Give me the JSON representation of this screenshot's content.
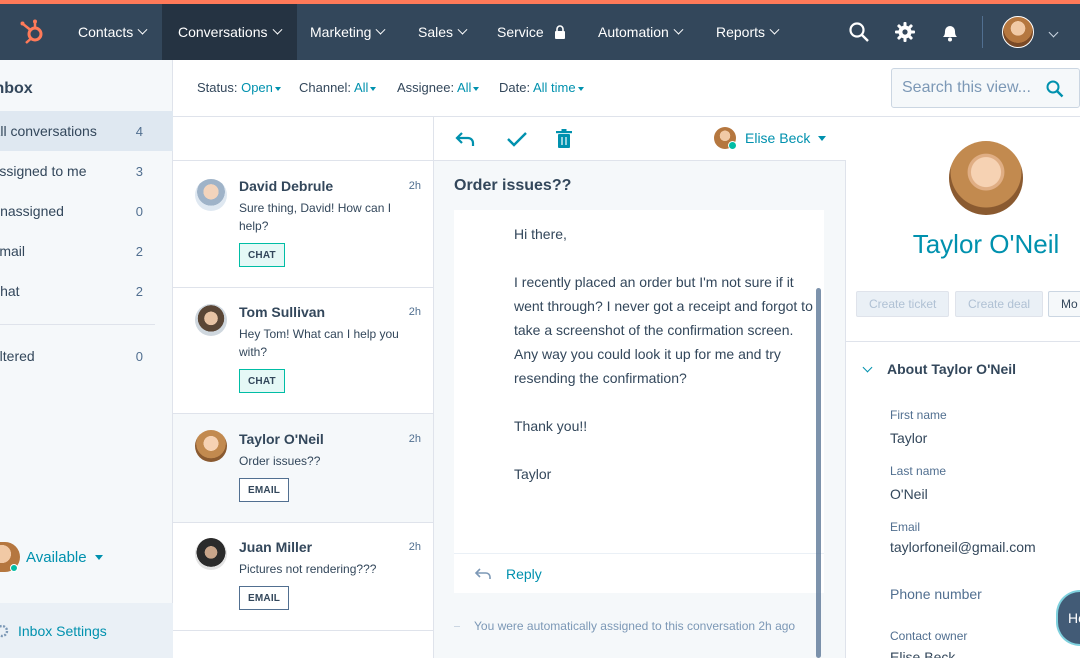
{
  "nav": {
    "items": [
      {
        "label": "Contacts"
      },
      {
        "label": "Conversations"
      },
      {
        "label": "Marketing"
      },
      {
        "label": "Sales"
      },
      {
        "label": "Service"
      },
      {
        "label": "Automation"
      },
      {
        "label": "Reports"
      }
    ],
    "brand_color": "#ff7a59",
    "bar_color": "#33475b"
  },
  "sidebar": {
    "title": "Inbox",
    "items": [
      {
        "label": "All conversations",
        "count": "4"
      },
      {
        "label": "Assigned to me",
        "count": "3"
      },
      {
        "label": "Unassigned",
        "count": "0"
      },
      {
        "label": "Email",
        "count": "2"
      },
      {
        "label": "Chat",
        "count": "2"
      },
      {
        "label": "Filtered",
        "count": "0"
      }
    ],
    "availability": "Available",
    "settings_label": "Inbox Settings"
  },
  "filters": {
    "status": {
      "label": "Status:",
      "value": "Open"
    },
    "channel": {
      "label": "Channel:",
      "value": "All"
    },
    "assignee": {
      "label": "Assignee:",
      "value": "All"
    },
    "date": {
      "label": "Date:",
      "value": "All time"
    },
    "search_placeholder": "Search this view..."
  },
  "conversations": [
    {
      "name": "David Debrule",
      "time": "2h",
      "preview": "Sure thing, David! How can I help?",
      "tag": "CHAT"
    },
    {
      "name": "Tom Sullivan",
      "time": "2h",
      "preview": "Hey Tom! What can I help you with?",
      "tag": "CHAT"
    },
    {
      "name": "Taylor O'Neil",
      "time": "2h",
      "preview": "Order issues??",
      "tag": "EMAIL"
    },
    {
      "name": "Juan Miller",
      "time": "2h",
      "preview": "Pictures not rendering???",
      "tag": "EMAIL"
    }
  ],
  "thread": {
    "assignee": "Elise Beck",
    "subject": "Order issues??",
    "greeting": "Hi there,",
    "body": "I recently placed an order but I'm not sure if it went through? I never got a receipt and forgot to take a screenshot of the confirmation screen. Any way you could look it up for me and try resending the confirmation?",
    "thanks": "Thank you!!",
    "signature": "Taylor",
    "reply_label": "Reply",
    "system_note": "You were automatically assigned to this conversation 2h ago"
  },
  "contact": {
    "name": "Taylor O'Neil",
    "buttons": {
      "create_ticket": "Create ticket",
      "create_deal": "Create deal",
      "more": "Mo"
    },
    "section_title": "About Taylor O'Neil",
    "first_name_label": "First name",
    "first_name": "Taylor",
    "last_name_label": "Last name",
    "last_name": "O'Neil",
    "email_label": "Email",
    "email": "taylorfoneil@gmail.com",
    "phone_label": "Phone number",
    "owner_label": "Contact owner",
    "owner": "Elise Beck"
  },
  "help_label": "He",
  "accent_color": "#0091ae"
}
